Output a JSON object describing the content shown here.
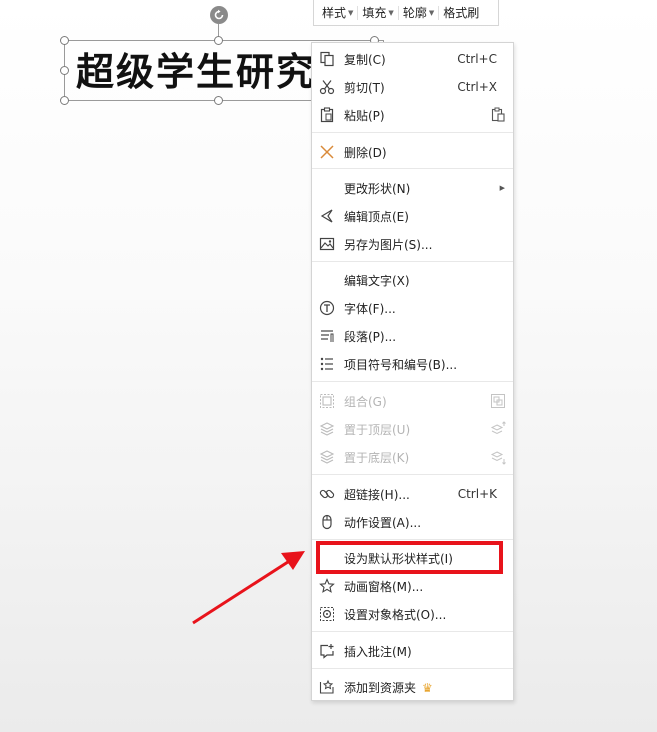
{
  "mini_toolbar": {
    "style_label": "样式",
    "fill_label": "填充",
    "outline_label": "轮廓",
    "format_painter_label": "格式刷"
  },
  "shape": {
    "text": "超级学生研究"
  },
  "menu": {
    "copy": {
      "label": "复制(C)",
      "shortcut": "Ctrl+C"
    },
    "cut": {
      "label": "剪切(T)",
      "shortcut": "Ctrl+X"
    },
    "paste": {
      "label": "粘贴(P)"
    },
    "delete": {
      "label": "删除(D)"
    },
    "change_shape": {
      "label": "更改形状(N)"
    },
    "edit_points": {
      "label": "编辑顶点(E)"
    },
    "save_as_picture": {
      "label": "另存为图片(S)..."
    },
    "edit_text": {
      "label": "编辑文字(X)"
    },
    "font": {
      "label": "字体(F)..."
    },
    "paragraph": {
      "label": "段落(P)..."
    },
    "bullets": {
      "label": "项目符号和编号(B)..."
    },
    "group": {
      "label": "组合(G)"
    },
    "bring_to_front": {
      "label": "置于顶层(U)"
    },
    "send_to_back": {
      "label": "置于底层(K)"
    },
    "hyperlink": {
      "label": "超链接(H)...",
      "shortcut": "Ctrl+K"
    },
    "action_settings": {
      "label": "动作设置(A)..."
    },
    "set_default_style": {
      "label": "设为默认形状样式(I)"
    },
    "animation_pane": {
      "label": "动画窗格(M)..."
    },
    "format_object": {
      "label": "设置对象格式(O)..."
    },
    "insert_comment": {
      "label": "插入批注(M)"
    },
    "add_to_library": {
      "label": "添加到资源夹"
    }
  },
  "colors": {
    "highlight": "#e8131b",
    "arrow": "#e8131b",
    "delete_icon": "#d98a3a",
    "crown": "#e8a530"
  }
}
